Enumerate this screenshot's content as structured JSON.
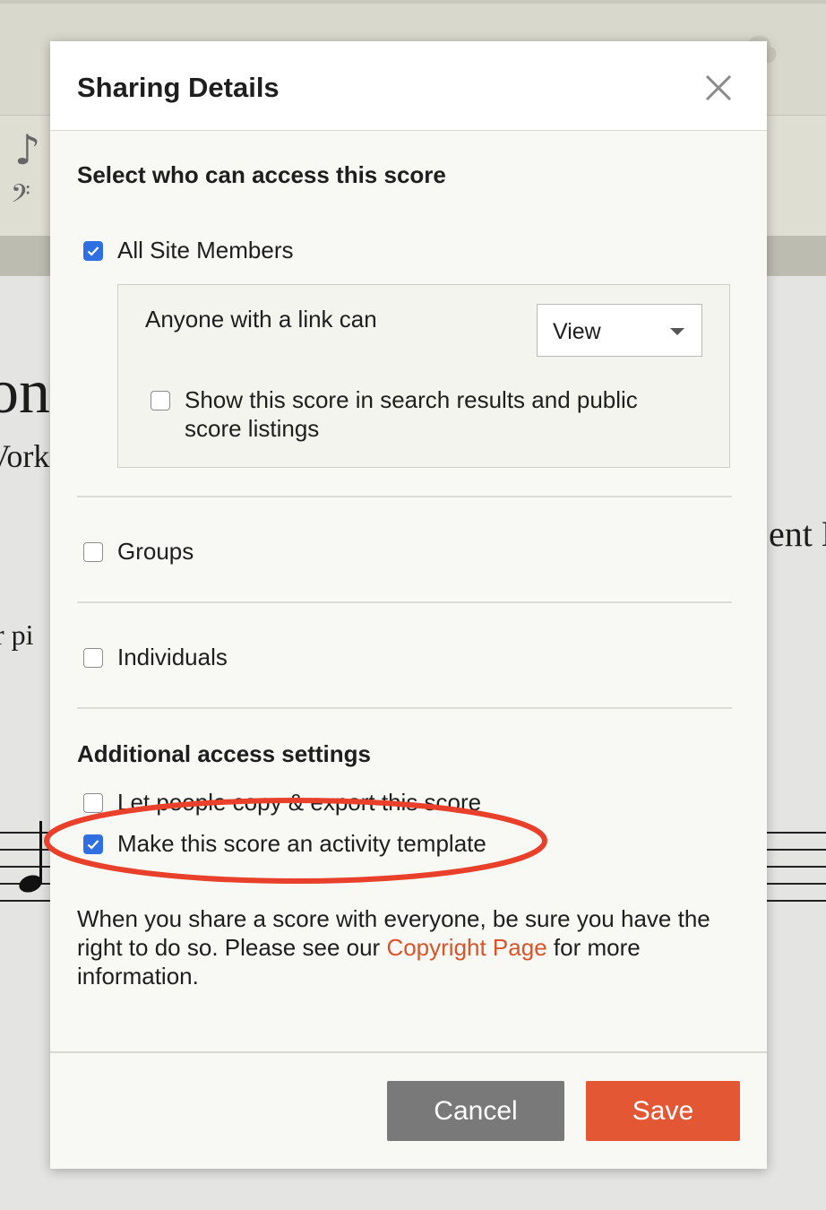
{
  "background": {
    "title_fragment": "on",
    "subtitle_fragment": "Vork",
    "right_fragment": "ent N",
    "left_fragment": "r pi",
    "note_glyph": "♪",
    "clef_glyph": "𝄢"
  },
  "modal": {
    "title": "Sharing Details",
    "access_heading": "Select who can access this score",
    "all_site_members": {
      "label": "All Site Members",
      "checked": true
    },
    "link_access": {
      "label": "Anyone with a link can",
      "selected": "View"
    },
    "show_in_search": {
      "label": "Show this score in search results and public score listings",
      "checked": false
    },
    "groups": {
      "label": "Groups",
      "checked": false
    },
    "individuals": {
      "label": "Individuals",
      "checked": false
    },
    "additional_heading": "Additional access settings",
    "copy_export": {
      "label": "Let people copy & export this score",
      "checked": false
    },
    "activity_template": {
      "label": "Make this score an activity template",
      "checked": true
    },
    "notice_before": "When you share a score with everyone, be sure you have the right to do so. Please see our ",
    "notice_link": "Copyright Page",
    "notice_after": " for more information.",
    "cancel_label": "Cancel",
    "save_label": "Save"
  },
  "colors": {
    "accent": "#e35734",
    "link": "#d9542a",
    "checkbox_checked": "#2f6fe2",
    "highlight": "#e8402a"
  }
}
